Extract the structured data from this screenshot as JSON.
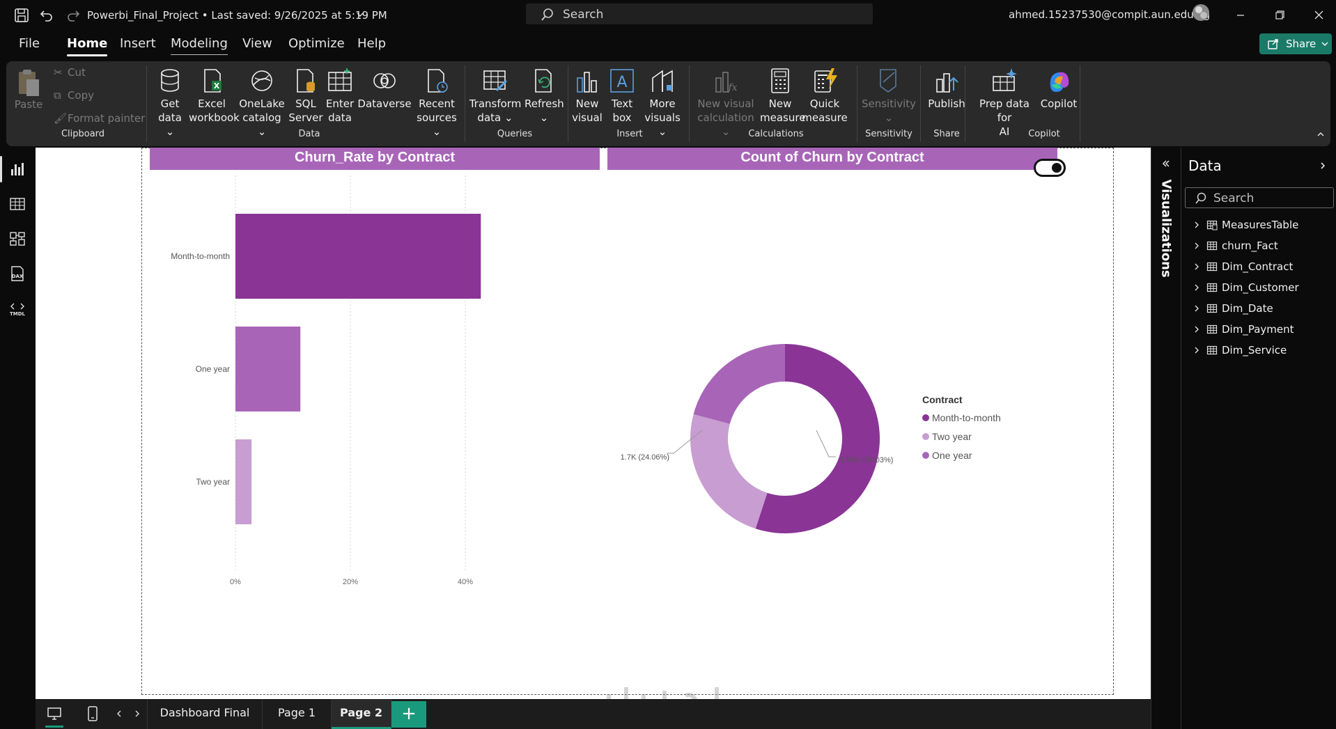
{
  "titlebar": {
    "doc_title": "Powerbi_Final_Project • Last saved: 9/26/2025 at 5:19 PM",
    "search_placeholder": "Search",
    "user_email": "ahmed.15237530@compit.aun.edu.eg"
  },
  "menu": {
    "items": [
      "File",
      "Home",
      "Insert",
      "Modeling",
      "View",
      "Optimize",
      "Help"
    ],
    "active": "Home",
    "share_label": "Share"
  },
  "ribbon": {
    "clipboard": {
      "paste": "Paste",
      "cut": "Cut",
      "copy": "Copy",
      "format_painter": "Format painter",
      "label": "Clipboard"
    },
    "data": {
      "get_data": [
        "Get",
        "data"
      ],
      "excel": [
        "Excel",
        "workbook"
      ],
      "onelake": [
        "OneLake",
        "catalog"
      ],
      "sql": [
        "SQL",
        "Server"
      ],
      "enter": [
        "Enter",
        "data"
      ],
      "dataverse": "Dataverse",
      "recent": [
        "Recent",
        "sources"
      ],
      "label": "Data"
    },
    "queries": {
      "transform": [
        "Transform",
        "data"
      ],
      "refresh": "Refresh",
      "label": "Queries"
    },
    "insert": {
      "new_visual": [
        "New",
        "visual"
      ],
      "text_box": [
        "Text",
        "box"
      ],
      "more_visuals": [
        "More",
        "visuals"
      ],
      "label": "Insert"
    },
    "calculations": {
      "new_visual_calc": [
        "New visual",
        "calculation"
      ],
      "new_measure": [
        "New",
        "measure"
      ],
      "quick_measure": [
        "Quick",
        "measure"
      ],
      "label": "Calculations"
    },
    "sensitivity": {
      "btn": "Sensitivity",
      "label": "Sensitivity"
    },
    "share": {
      "publish": "Publish",
      "label": "Share"
    },
    "copilot": {
      "prep": [
        "Prep data for",
        "AI"
      ],
      "copilot": "Copilot",
      "label": "Copilot"
    }
  },
  "canvas": {
    "bar_chart_title": "Churn_Rate by Contract",
    "donut_chart_title": "Count of Churn by Contract",
    "legend_title": "Contract"
  },
  "chart_data": [
    {
      "type": "bar",
      "orientation": "horizontal",
      "title": "Churn_Rate by Contract",
      "categories": [
        "Month-to-month",
        "One year",
        "Two year"
      ],
      "values": [
        42.7,
        11.3,
        2.8
      ],
      "unit": "%",
      "xlim": [
        0,
        40
      ],
      "xticks": [
        "0%",
        "20%",
        "40%"
      ],
      "colors": [
        "#8a3496",
        "#a865b8",
        "#c89dd1"
      ],
      "grid": true
    },
    {
      "type": "pie",
      "variant": "donut",
      "title": "Count of Churn by Contract",
      "legend_title": "Contract",
      "legend_position": "right",
      "slices": [
        {
          "name": "Month-to-month",
          "value": 3880,
          "label": "3.88K (55.03%)",
          "color": "#8a3496"
        },
        {
          "name": "Two year",
          "value": 1700,
          "label": "1.7K (24.06%)",
          "color": "#c89dd1"
        },
        {
          "name": "One year",
          "value": 1470,
          "label": "1.47K (20.9%)",
          "color": "#a865b8"
        }
      ]
    }
  ],
  "data_pane": {
    "title": "Data",
    "search_placeholder": "Search",
    "tables": [
      "MeasuresTable",
      "churn_Fact",
      "Dim_Contract",
      "Dim_Customer",
      "Dim_Date",
      "Dim_Payment",
      "Dim_Service"
    ]
  },
  "viz_pane_label": "Visualizations",
  "pages": {
    "tabs": [
      "Dashboard Final",
      "Page 1",
      "Page 2"
    ],
    "active": "Page 2",
    "add": "+"
  }
}
